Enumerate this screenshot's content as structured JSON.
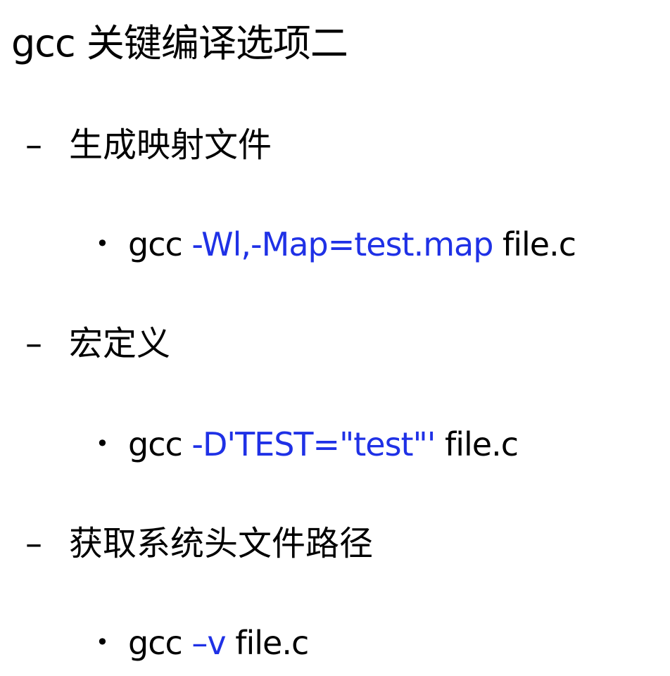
{
  "title": "gcc 关键编译选项二",
  "colors": {
    "text": "#000000",
    "option": "#1f31e6"
  },
  "items": [
    {
      "heading": "生成映射文件",
      "command": {
        "prefix": "gcc ",
        "option": "-Wl,-Map=test.map",
        "suffix": " file.c"
      }
    },
    {
      "heading": "宏定义",
      "command": {
        "prefix": "gcc ",
        "option": "-D'TEST=\"test\"'",
        "suffix": " file.c"
      }
    },
    {
      "heading": "获取系统头文件路径",
      "command": {
        "prefix": "gcc ",
        "option": "–v",
        "suffix": " file.c"
      }
    }
  ],
  "markers": {
    "dash": "–",
    "bullet": "•"
  }
}
